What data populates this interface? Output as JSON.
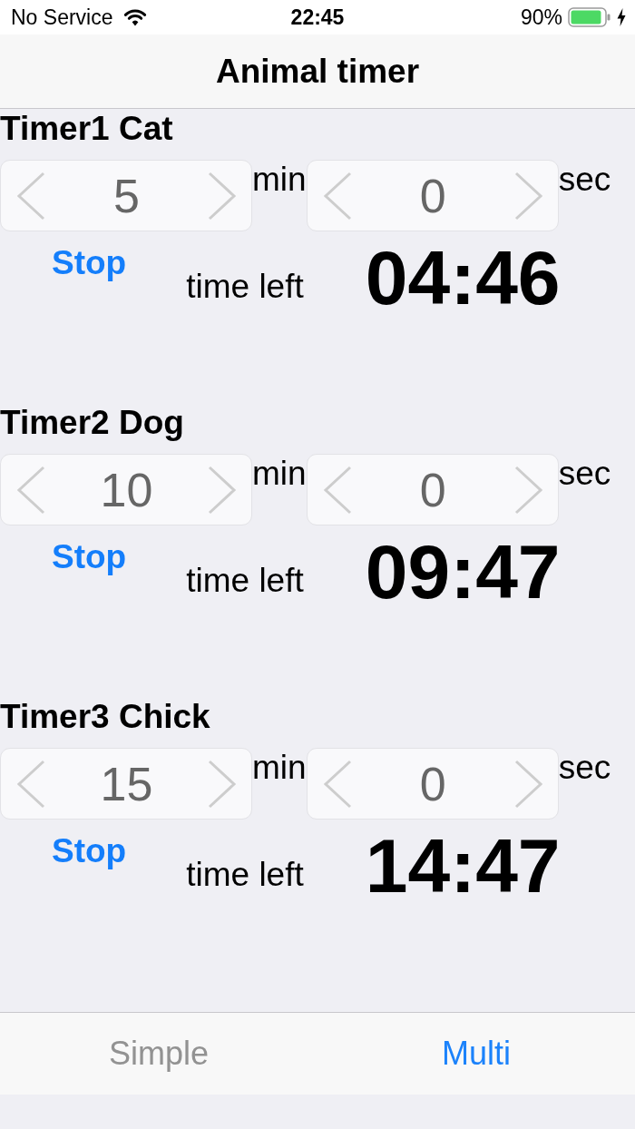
{
  "status_bar": {
    "carrier": "No Service",
    "time": "22:45",
    "battery": "90%"
  },
  "nav_bar": {
    "title": "Animal timer"
  },
  "timers": [
    {
      "title": "Timer1 Cat",
      "minutes": {
        "value": "5",
        "unit": "min"
      },
      "seconds": {
        "value": "0",
        "unit": "sec"
      },
      "button": "Stop",
      "time_left_label": "time left",
      "countdown": "04:46"
    },
    {
      "title": "Timer2 Dog",
      "minutes": {
        "value": "10",
        "unit": "min"
      },
      "seconds": {
        "value": "0",
        "unit": "sec"
      },
      "button": "Stop",
      "time_left_label": "time left",
      "countdown": "09:47"
    },
    {
      "title": "Timer3 Chick",
      "minutes": {
        "value": "15",
        "unit": "min"
      },
      "seconds": {
        "value": "0",
        "unit": "sec"
      },
      "button": "Stop",
      "time_left_label": "time left",
      "countdown": "14:47"
    }
  ],
  "tab_bar": {
    "tabs": [
      {
        "label": "Simple",
        "selected": false
      },
      {
        "label": "Multi",
        "selected": true
      }
    ]
  }
}
